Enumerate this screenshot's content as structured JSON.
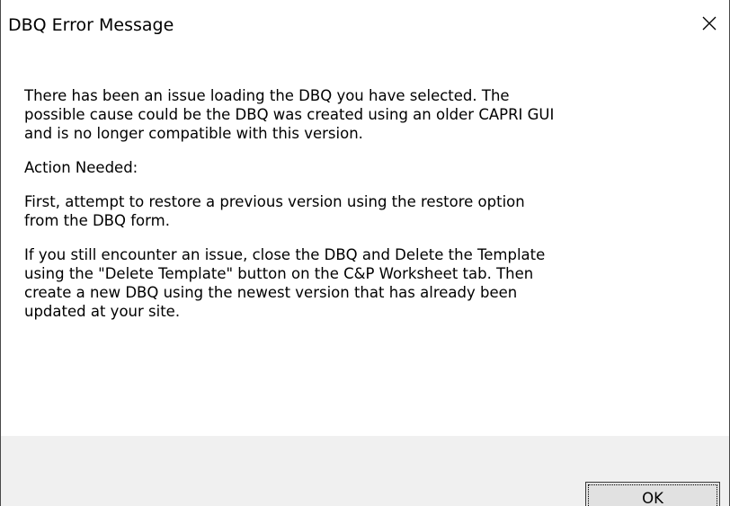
{
  "window": {
    "title": "DBQ Error Message",
    "close_icon": "close-icon"
  },
  "message": {
    "paragraphs": [
      "There has been an issue loading the DBQ you have selected.  The\npossible cause could be the DBQ was created using an older CAPRI GUI\nand is no longer compatible with this version.",
      "Action Needed:",
      "First, attempt to restore a previous version using the restore option\nfrom the DBQ form.",
      "If you still encounter an issue, close the DBQ and Delete the Template\nusing the \"Delete Template\" button on the C&P Worksheet tab.  Then\ncreate a new DBQ using the newest version that has already been\nupdated at your site."
    ]
  },
  "buttons": {
    "ok_label": "OK"
  },
  "colors": {
    "footer_background": "#f0f0f0",
    "button_background": "#e1e1e1",
    "window_border": "#4a4a4a"
  }
}
